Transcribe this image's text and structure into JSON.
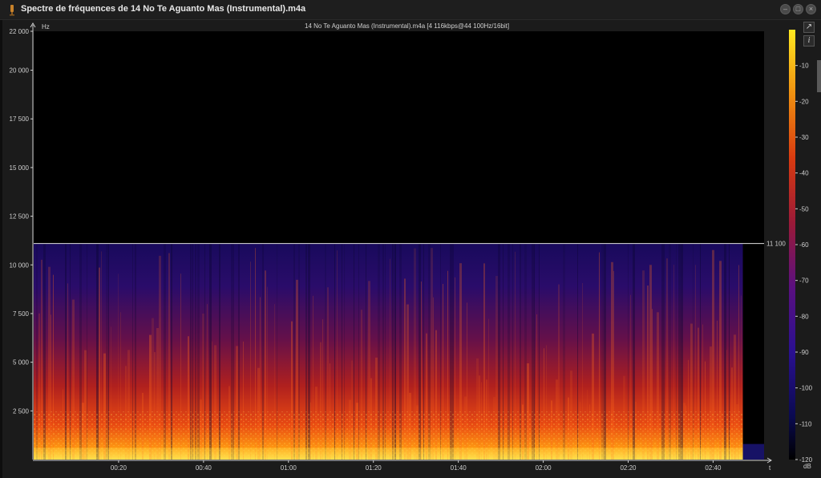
{
  "window": {
    "title": "Spectre de fréquences de 14 No Te Aguanto Mas (Instrumental).m4a",
    "icon": "audio-file-icon"
  },
  "plot": {
    "title": "14 No Te Aguanto Mas (Instrumental).m4a [4 116kbps@44 100Hz/16bit]"
  },
  "side_buttons": {
    "export_icon": "export-icon",
    "info_label": "i"
  },
  "colors": {
    "background": "#000000",
    "spectrum_low": "#1a0a5a",
    "spectrum_mid": "#c0281e",
    "spectrum_high": "#ffd000",
    "cutoff_line": "#e0e0e0"
  },
  "chart_data": {
    "type": "heatmap",
    "title": "14 No Te Aguanto Mas (Instrumental).m4a [4 116kbps@44 100Hz/16bit]",
    "ylabel": "Hz",
    "xlabel": "t",
    "ylim": [
      0,
      22000
    ],
    "y_ticks": [
      2500,
      5000,
      7500,
      10000,
      12500,
      15000,
      17500,
      20000,
      22000
    ],
    "y_tick_labels": [
      "2 500",
      "5 000",
      "7 500",
      "10 000",
      "12 500",
      "15 000",
      "17 500",
      "20 000",
      "22 000"
    ],
    "xlim_seconds": [
      0,
      172
    ],
    "x_ticks_seconds": [
      20,
      40,
      60,
      80,
      100,
      120,
      140,
      160
    ],
    "x_tick_labels": [
      "00:20",
      "00:40",
      "01:00",
      "01:20",
      "01:40",
      "02:00",
      "02:20",
      "02:40"
    ],
    "audio_end_seconds": 167,
    "cutoff_hz": 11100,
    "cutoff_label": "11 100",
    "colorbar": {
      "label": "dB",
      "range": [
        -120,
        0
      ],
      "ticks": [
        -10,
        -20,
        -30,
        -40,
        -50,
        -60,
        -70,
        -80,
        -90,
        -100,
        -110,
        -120
      ],
      "tick_labels": [
        "-10",
        "-20",
        "-30",
        "-40",
        "-50",
        "-60",
        "-70",
        "-80",
        "-90",
        "-100",
        "-110",
        "-120"
      ]
    }
  }
}
